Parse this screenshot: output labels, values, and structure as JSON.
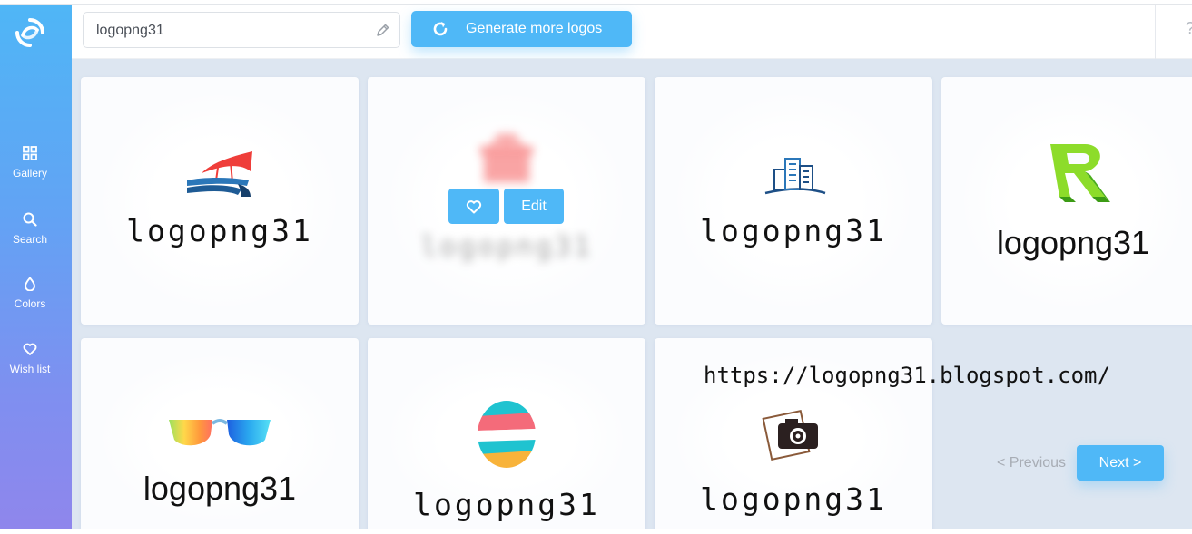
{
  "sidebar": {
    "logo_icon": "swirl-logo",
    "items": [
      {
        "label": "Gallery",
        "icon": "grid-icon"
      },
      {
        "label": "Search",
        "icon": "search-icon"
      },
      {
        "label": "Colors",
        "icon": "droplet-icon"
      },
      {
        "label": "Wish list",
        "icon": "heart-icon"
      }
    ]
  },
  "header": {
    "name_value": "logopng31",
    "generate_label": "Generate more logos",
    "help": "?"
  },
  "cards": [
    {
      "wordmark": "logopng31",
      "emblem": "sail-wave-emblem"
    },
    {
      "wordmark": "logopng31",
      "emblem": "gift-box-emblem",
      "hover": true,
      "edit_label": "Edit"
    },
    {
      "wordmark": "logopng31",
      "emblem": "building-emblem"
    },
    {
      "wordmark": "logopng31",
      "emblem": "green-r-emblem"
    },
    {
      "wordmark": "logopng31",
      "emblem": "sunglasses-emblem"
    },
    {
      "wordmark": "logopng31",
      "emblem": "striped-egg-emblem"
    },
    {
      "wordmark": "logopng31",
      "emblem": "camera-emblem"
    }
  ],
  "watermark": "https://logopng31.blogspot.com/",
  "pagination": {
    "previous_label": "< Previous",
    "next_label": "Next >"
  },
  "colors": {
    "accent": "#4fb8f7",
    "sidebar_top": "#4fb6f6",
    "sidebar_bottom": "#8f86ec",
    "background": "#dde6f1"
  }
}
